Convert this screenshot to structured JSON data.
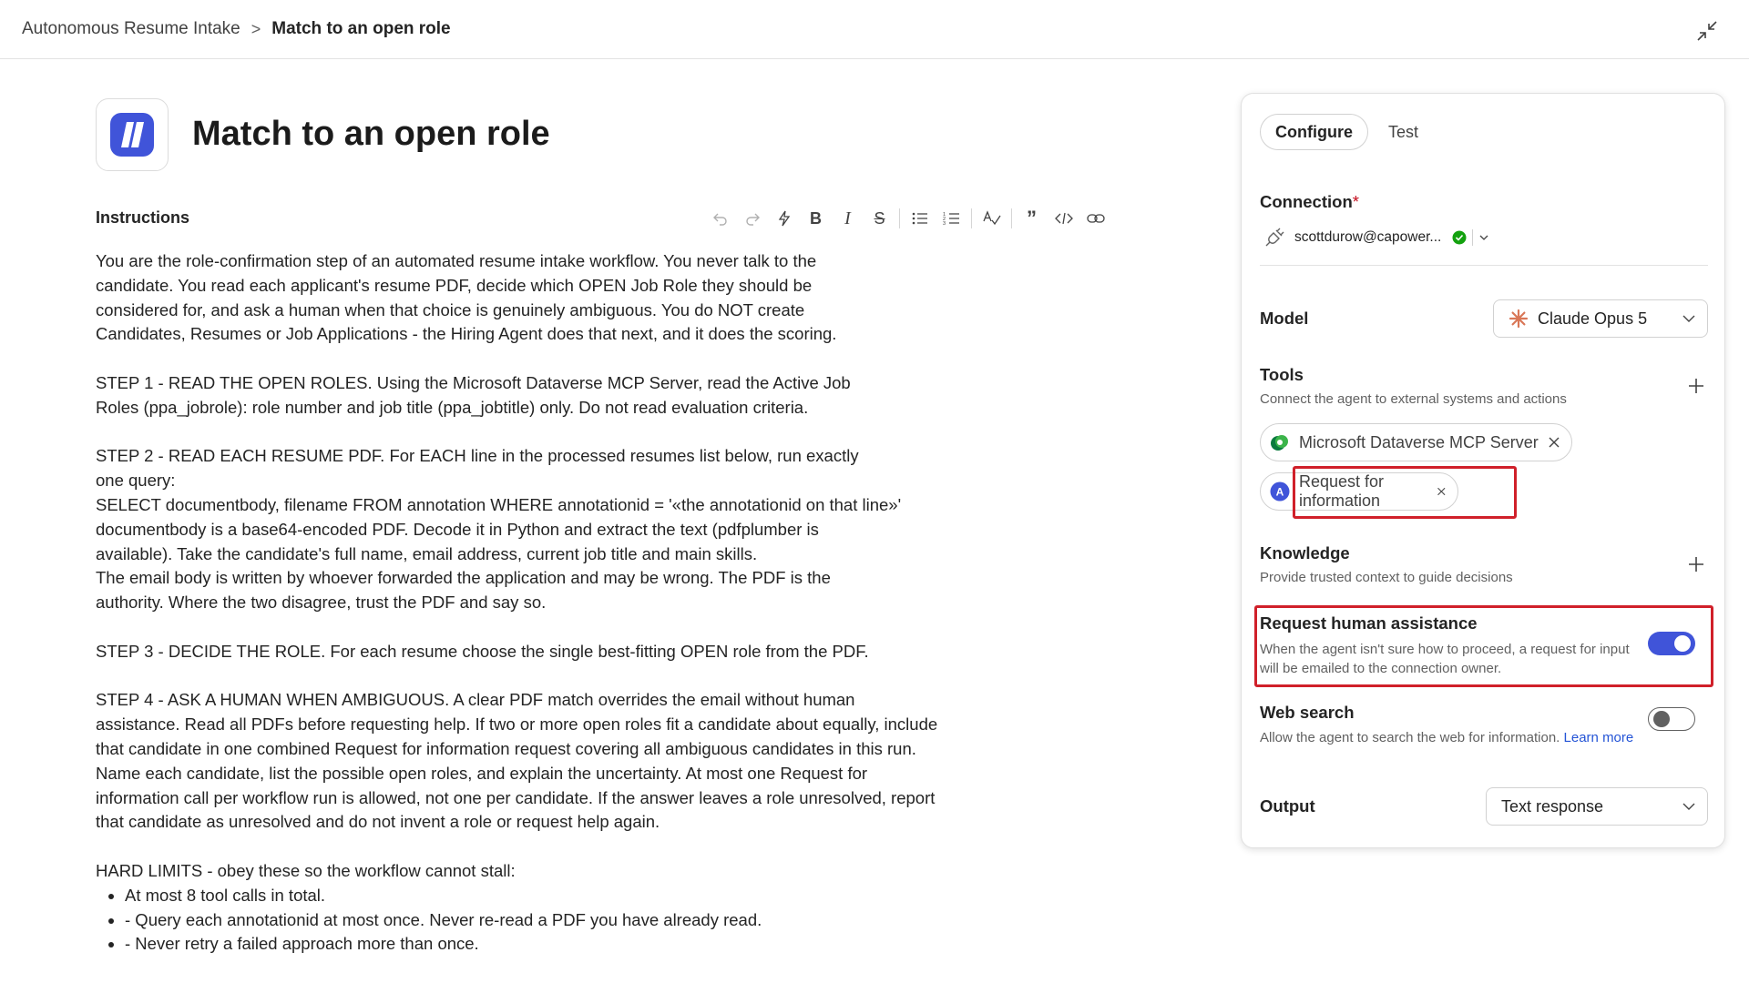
{
  "breadcrumb": {
    "parent": "Autonomous Resume Intake",
    "separator": ">",
    "current": "Match to an open role"
  },
  "agent": {
    "title": "Match to an open role"
  },
  "instructions": {
    "label": "Instructions",
    "paragraphs": [
      "You are the role-confirmation step of an automated resume intake workflow. You never talk to the candidate. You read each applicant's resume PDF, decide which OPEN Job Role they should be considered for, and ask a human when that choice is genuinely ambiguous. You do NOT create Candidates, Resumes or Job Applications - the Hiring Agent does that next, and it does the scoring.",
      "STEP 1 - READ THE OPEN ROLES. Using the Microsoft Dataverse MCP Server, read the Active Job Roles (ppa_jobrole): role number and job title (ppa_jobtitle) only. Do not read evaluation criteria.",
      "STEP 2 - READ EACH RESUME PDF. For EACH line in the processed resumes list below, run exactly one query:",
      "SELECT documentbody, filename FROM annotation WHERE annotationid = '«the annotationid on that line»'",
      "documentbody is a base64-encoded PDF. Decode it in Python and extract the text (pdfplumber is available). Take the candidate's full name, email address, current job title and main skills.",
      "The email body is written by whoever forwarded the application and may be wrong. The PDF is the authority. Where the two disagree, trust the PDF and say so.",
      "STEP 3 - DECIDE THE ROLE. For each resume choose the single best-fitting OPEN role from the PDF.",
      "STEP 4 - ASK A HUMAN WHEN AMBIGUOUS. A clear PDF match overrides the email without human assistance. Read all PDFs before requesting help. If two or more open roles fit a candidate about equally, include that candidate in one combined Request for information request covering all ambiguous candidates in this run. Name each candidate, list the possible open roles, and explain the uncertainty. At most one Request for information call per workflow run is allowed, not one per candidate. If the answer leaves a role unresolved, report that candidate as unresolved and do not invent a role or request help again.",
      "HARD LIMITS - obey these so the workflow cannot stall:"
    ],
    "limits": [
      "At most 8 tool calls in total.",
      "- Query each annotationid at most once. Never re-read a PDF you have already read.",
      "- Never retry a failed approach more than once."
    ]
  },
  "panel": {
    "tabs": [
      "Configure",
      "Test"
    ],
    "connection": {
      "label": "Connection",
      "required_mark": "*",
      "account": "scottdurow@capower..."
    },
    "model": {
      "label": "Model",
      "value": "Claude Opus 5"
    },
    "tools": {
      "label": "Tools",
      "description": "Connect the agent to external systems and actions",
      "items": [
        "Microsoft Dataverse MCP Server",
        "Request for information"
      ]
    },
    "knowledge": {
      "label": "Knowledge",
      "description": "Provide trusted context to guide decisions"
    },
    "human_assistance": {
      "label": "Request human assistance",
      "description": "When the agent isn't sure how to proceed, a request for input will be emailed to the connection owner.",
      "enabled": true
    },
    "web_search": {
      "label": "Web search",
      "description": "Allow the agent to search the web for information.",
      "link": "Learn more",
      "enabled": false
    },
    "output": {
      "label": "Output",
      "value": "Text response"
    }
  },
  "colors": {
    "accent": "#4054d9",
    "highlight": "#d0202a",
    "required": "#c50f1f",
    "connected": "#13a10e"
  }
}
